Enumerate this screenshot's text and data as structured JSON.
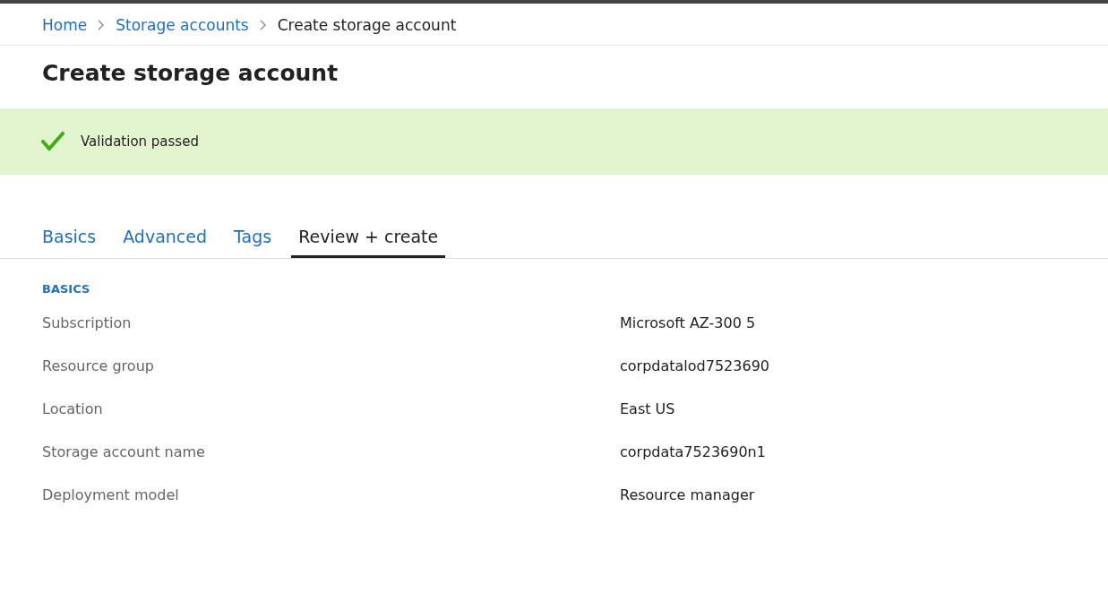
{
  "breadcrumb": [
    {
      "label": "Home",
      "link": true
    },
    {
      "label": "Storage accounts",
      "link": true
    },
    {
      "label": "Create storage account",
      "link": false
    }
  ],
  "title": "Create storage account",
  "banner": {
    "passed": true,
    "message": "Validation passed"
  },
  "tabs": [
    {
      "label": "Basics",
      "selected": false
    },
    {
      "label": "Advanced",
      "selected": false
    },
    {
      "label": "Tags",
      "selected": false
    },
    {
      "label": "Review + create",
      "selected": true
    }
  ],
  "section": {
    "heading": "BASICS",
    "rows": [
      {
        "label": "Subscription",
        "value": "Microsoft AZ-300 5"
      },
      {
        "label": "Resource group",
        "value": "corpdatalod7523690"
      },
      {
        "label": "Location",
        "value": "East US"
      },
      {
        "label": "Storage account name",
        "value": "corpdata7523690n1"
      },
      {
        "label": "Deployment model",
        "value": "Resource manager"
      }
    ]
  }
}
